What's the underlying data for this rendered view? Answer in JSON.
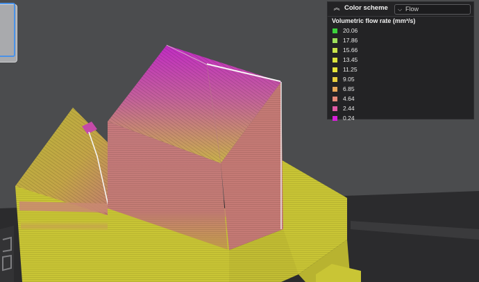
{
  "legend": {
    "header_title": "Color scheme",
    "scheme_value": "Flow",
    "subtitle": "Volumetric flow rate (mm³/s)",
    "items": [
      {
        "value": "20.06",
        "color": "#3bd23b"
      },
      {
        "value": "17.86",
        "color": "#9ee05a"
      },
      {
        "value": "15.66",
        "color": "#c9e34a"
      },
      {
        "value": "13.45",
        "color": "#dbe33d"
      },
      {
        "value": "11.25",
        "color": "#e6e43a"
      },
      {
        "value": "9.05",
        "color": "#e8cf3e"
      },
      {
        "value": "6.85",
        "color": "#e8a85a"
      },
      {
        "value": "4.64",
        "color": "#e58a7a"
      },
      {
        "value": "2.44",
        "color": "#e05aa6"
      },
      {
        "value": "0.24",
        "color": "#d61fd9"
      }
    ]
  },
  "colors": {
    "viewport_bg": "#4b4c4e",
    "bed": "#2a2a2c",
    "model_yellow": "#c9c535",
    "model_pink": "#c77b76",
    "model_magenta": "#c12cc3"
  }
}
